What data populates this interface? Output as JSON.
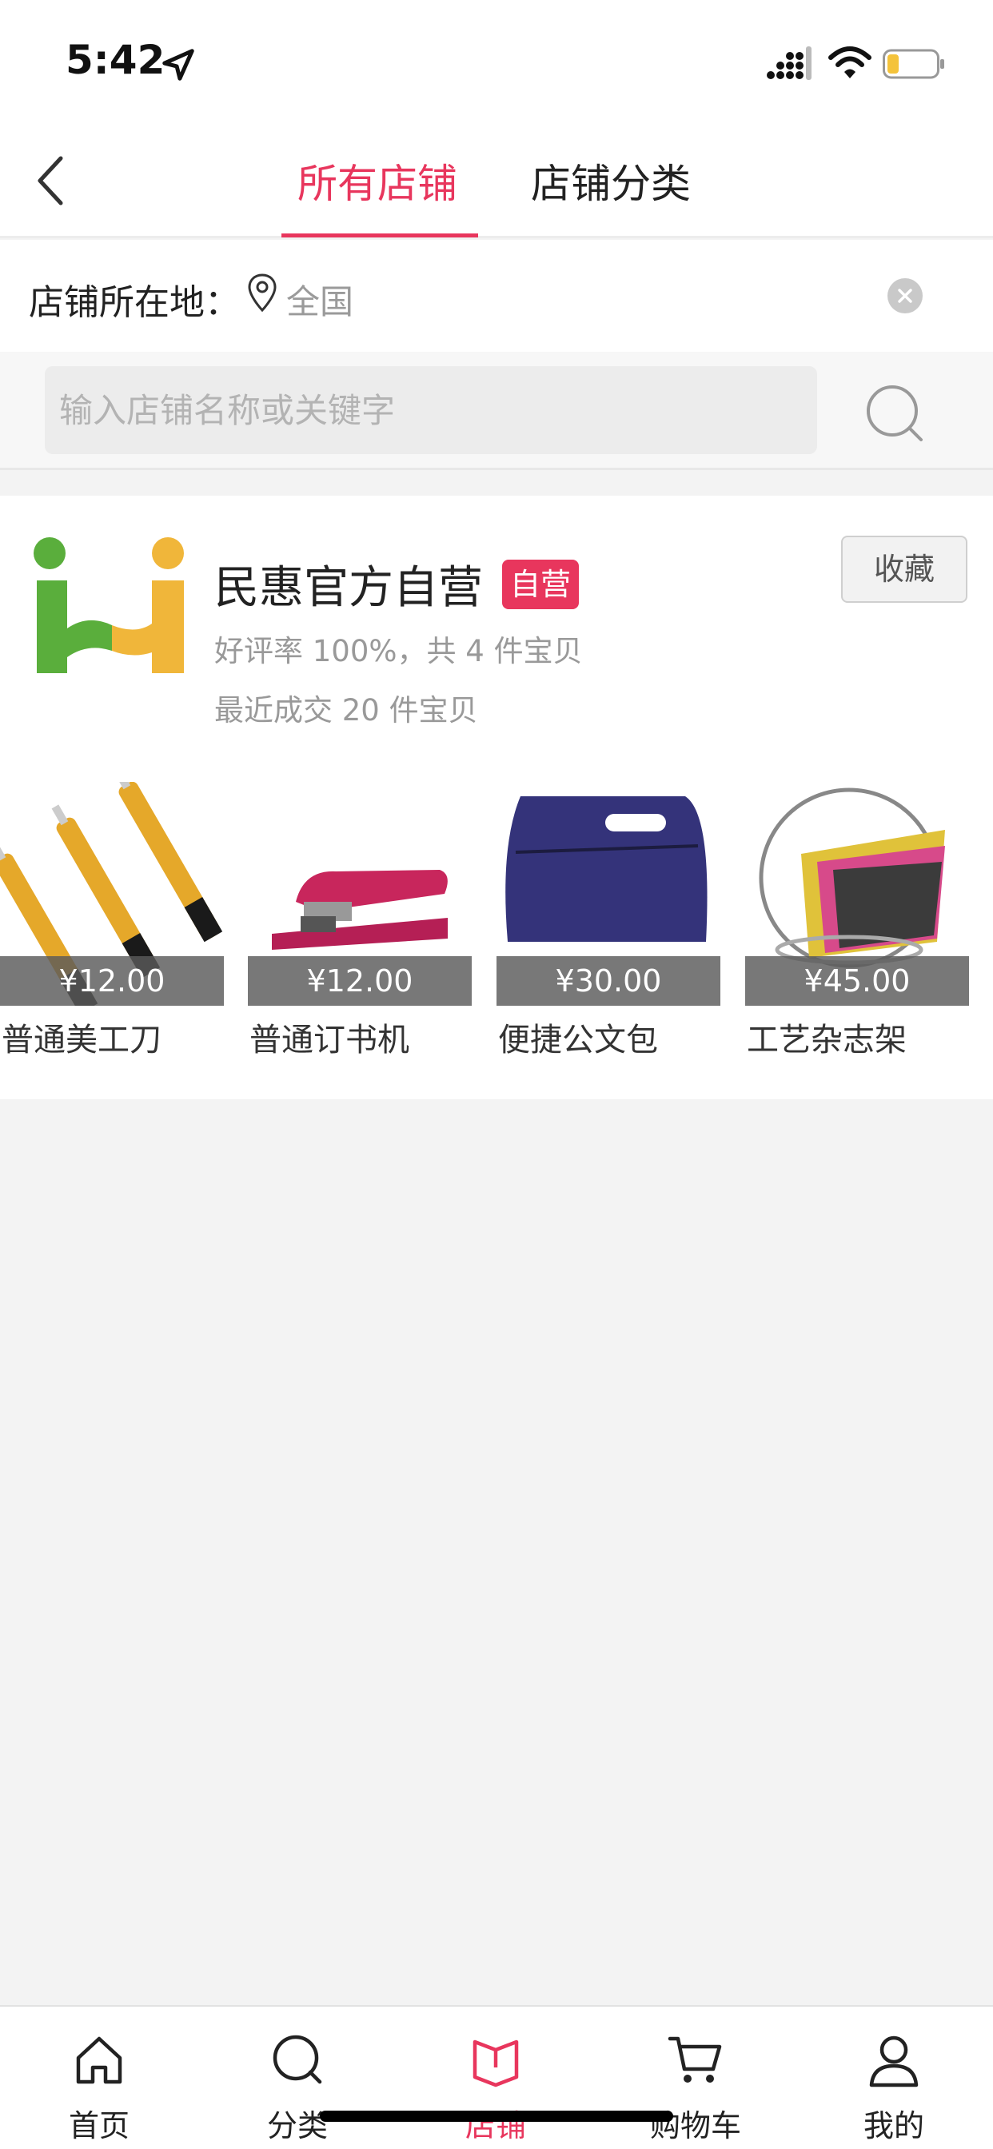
{
  "status_bar": {
    "time": "5:42"
  },
  "header": {
    "tabs": [
      {
        "label": "所有店铺",
        "active": true
      },
      {
        "label": "店铺分类",
        "active": false
      }
    ]
  },
  "location": {
    "label": "店铺所在地：",
    "value": "全国"
  },
  "search": {
    "placeholder": "输入店铺名称或关键字"
  },
  "store": {
    "name": "民惠官方自营",
    "badge": "自营",
    "rating_text": "好评率 100%，共 4 件宝贝",
    "sales_text": "最近成交 20 件宝贝",
    "favorite_label": "收藏",
    "products": [
      {
        "name": "普通美工刀",
        "price": "¥12.00"
      },
      {
        "name": "普通订书机",
        "price": "¥12.00"
      },
      {
        "name": "便捷公文包",
        "price": "¥30.00"
      },
      {
        "name": "工艺杂志架",
        "price": "¥45.00"
      }
    ]
  },
  "tabbar": {
    "items": [
      {
        "label": "首页",
        "icon": "home-icon"
      },
      {
        "label": "分类",
        "icon": "category-search-icon"
      },
      {
        "label": "店铺",
        "icon": "store-book-icon",
        "active": true
      },
      {
        "label": "购物车",
        "icon": "cart-icon"
      },
      {
        "label": "我的",
        "icon": "user-icon"
      }
    ]
  },
  "colors": {
    "accent": "#e8365d",
    "logo_green": "#5aae3c",
    "logo_yellow": "#f0b63a"
  }
}
